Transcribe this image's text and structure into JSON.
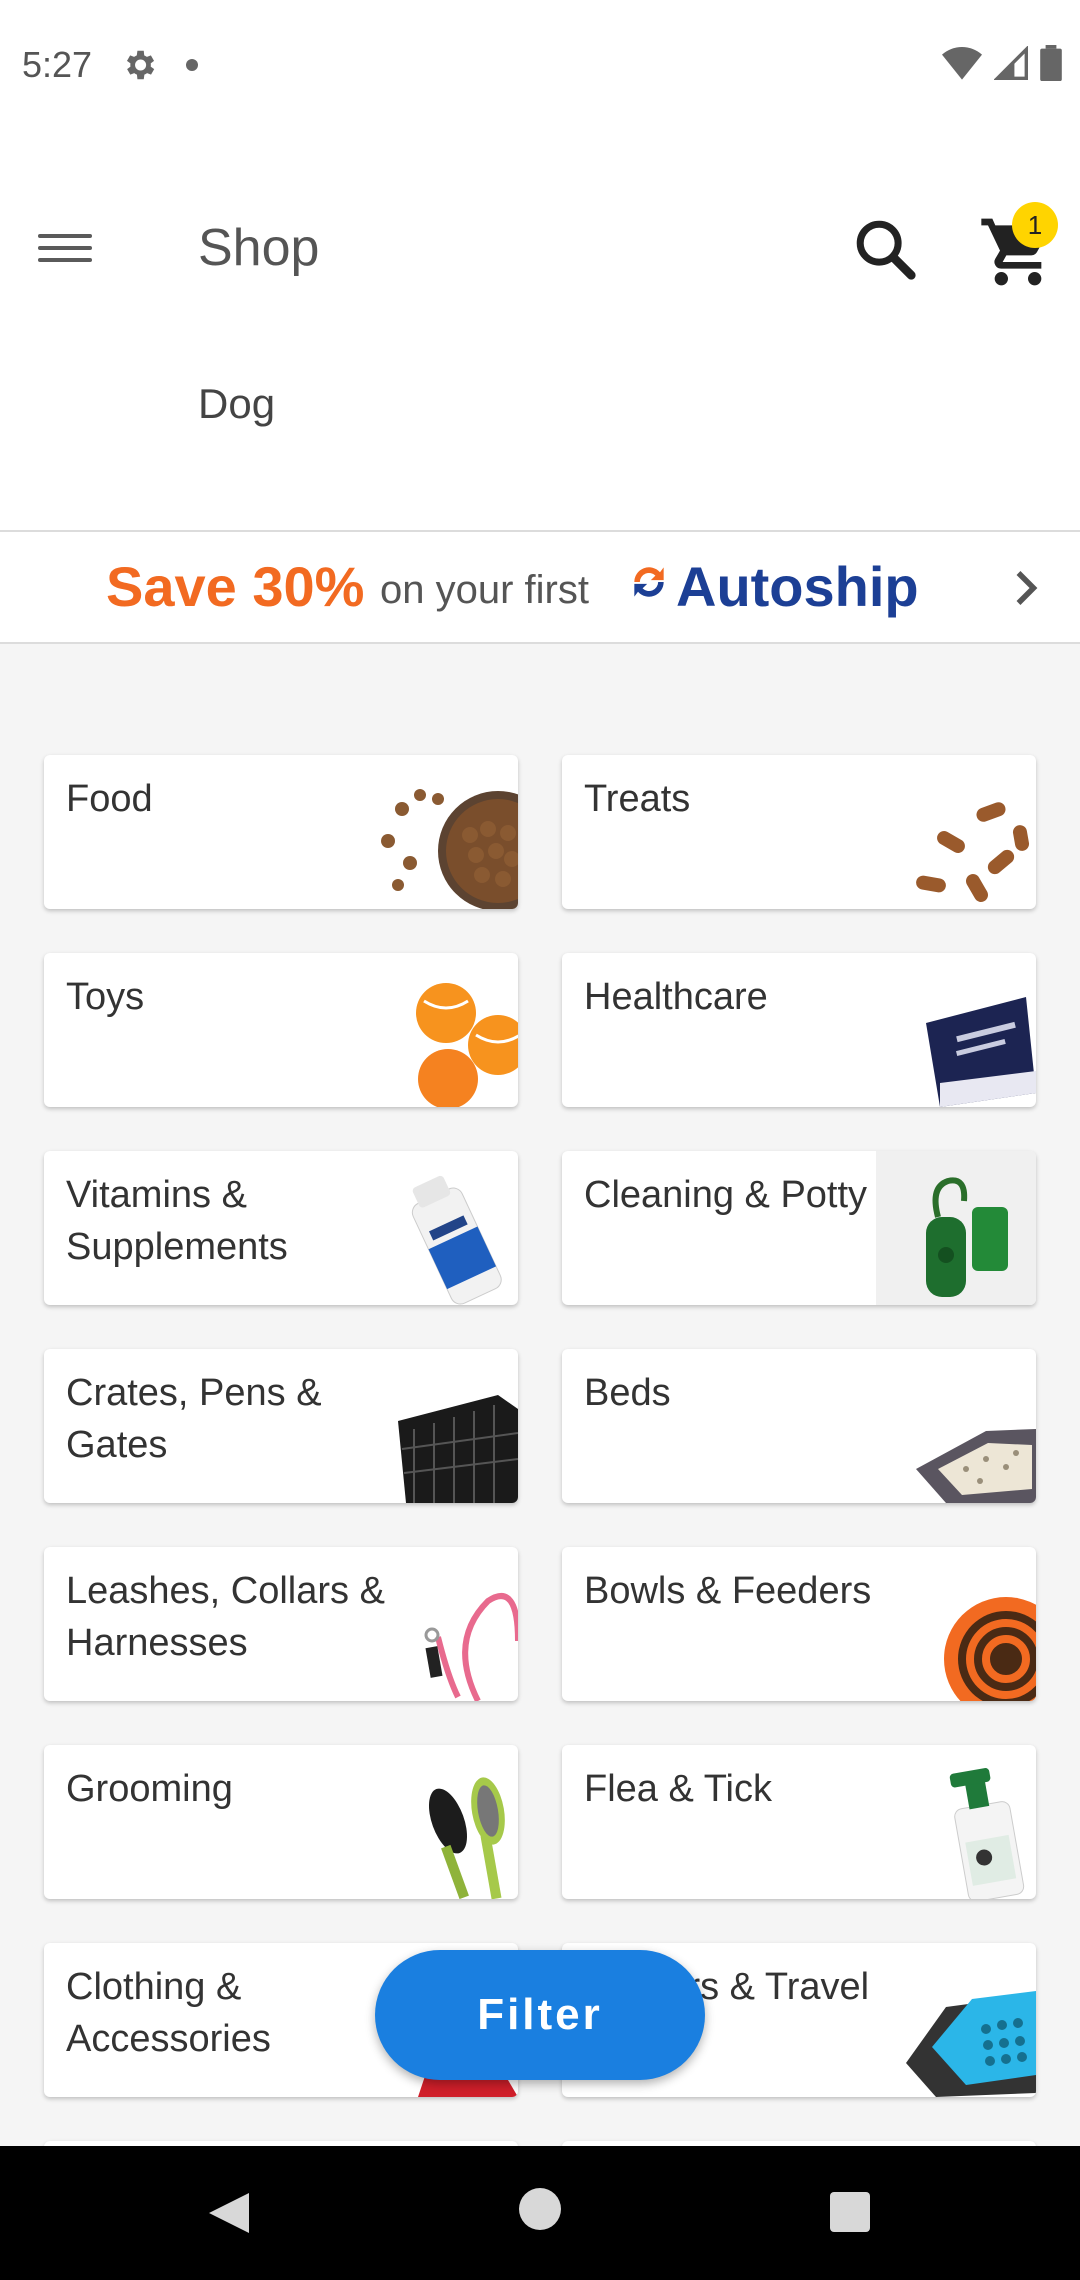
{
  "status_bar": {
    "time": "5:27",
    "icons": [
      "gear-icon",
      "notification-dot-icon",
      "wifi-icon",
      "signal-icon",
      "battery-icon"
    ]
  },
  "header": {
    "title": "Shop",
    "subtitle": "Dog",
    "cart_count": "1",
    "icons": [
      "menu-icon",
      "search-icon",
      "cart-icon"
    ]
  },
  "promo": {
    "save_text": "Save 30%",
    "middle_text": "on your first",
    "brand_text": "Autoship",
    "colors": {
      "save": "#f26a21",
      "brand": "#1c3f95"
    }
  },
  "categories": [
    {
      "label": "Food",
      "image": "kibble-bowl"
    },
    {
      "label": "Treats",
      "image": "bone-treats"
    },
    {
      "label": "Toys",
      "image": "tennis-balls"
    },
    {
      "label": "Healthcare",
      "image": "supplement-box"
    },
    {
      "label": "Vitamins & Supplements",
      "image": "oil-bottle"
    },
    {
      "label": "Cleaning & Potty",
      "image": "poop-bag-holder"
    },
    {
      "label": "Crates, Pens & Gates",
      "image": "wire-crate"
    },
    {
      "label": "Beds",
      "image": "dog-bed"
    },
    {
      "label": "Leashes, Collars & Harnesses",
      "image": "leash"
    },
    {
      "label": "Bowls & Feeders",
      "image": "slow-feeder"
    },
    {
      "label": "Grooming",
      "image": "brushes"
    },
    {
      "label": "Flea & Tick",
      "image": "spray-bottle"
    },
    {
      "label": "Clothing & Accessories",
      "image": "dog-sweater"
    },
    {
      "label": "Carriers & Travel",
      "image": "pet-carrier"
    }
  ],
  "filter_button": {
    "label": "Filter",
    "color": "#1a7fe0"
  },
  "nav_bar": {
    "icons": [
      "back-icon",
      "home-icon",
      "recents-icon"
    ]
  }
}
